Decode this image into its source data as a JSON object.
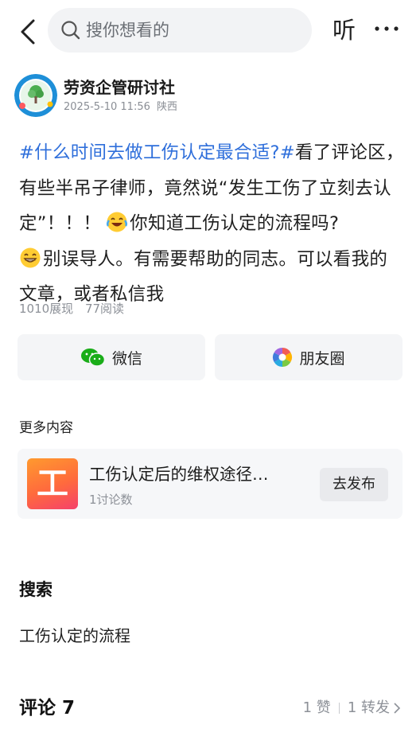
{
  "header": {
    "search_placeholder": "搜你想看的",
    "listen_label": "听"
  },
  "author": {
    "name": "劳资企管研讨社",
    "datetime": "2025-5-10 11:56",
    "location": "陕西"
  },
  "post": {
    "hashtag": "#什么时间去做工伤认定最合适?#",
    "text_1": "看了评论区，有些半吊子律师，竟然说“发生工伤了立刻去认定”！！！",
    "text_2": "你知道工伤认定的流程吗?",
    "text_3": "别误导人。有需要帮助的同志。可以看我的文章，或者私信我",
    "emoji_1": "laughing-crying-emoji",
    "emoji_2": "grinning-emoji"
  },
  "stats": {
    "impressions": "1010展现",
    "reads": "77阅读"
  },
  "share": {
    "wechat_label": "微信",
    "moments_label": "朋友圈"
  },
  "more_content": {
    "section_label": "更多内容",
    "card": {
      "thumb_glyph": "工",
      "title": "工伤认定后的维权途径…",
      "subtitle": "1讨论数",
      "button_label": "去发布"
    }
  },
  "search_section": {
    "heading": "搜索",
    "related_query": "工伤认定的流程"
  },
  "comments": {
    "title": "评论 7",
    "likes": "1 赞",
    "reposts": "1 转发"
  },
  "colors": {
    "hashtag": "#2f6fdb",
    "wechat_green": "#1aad19",
    "card_thumb": "#ff6a3d",
    "muted_text": "#8d9198"
  }
}
